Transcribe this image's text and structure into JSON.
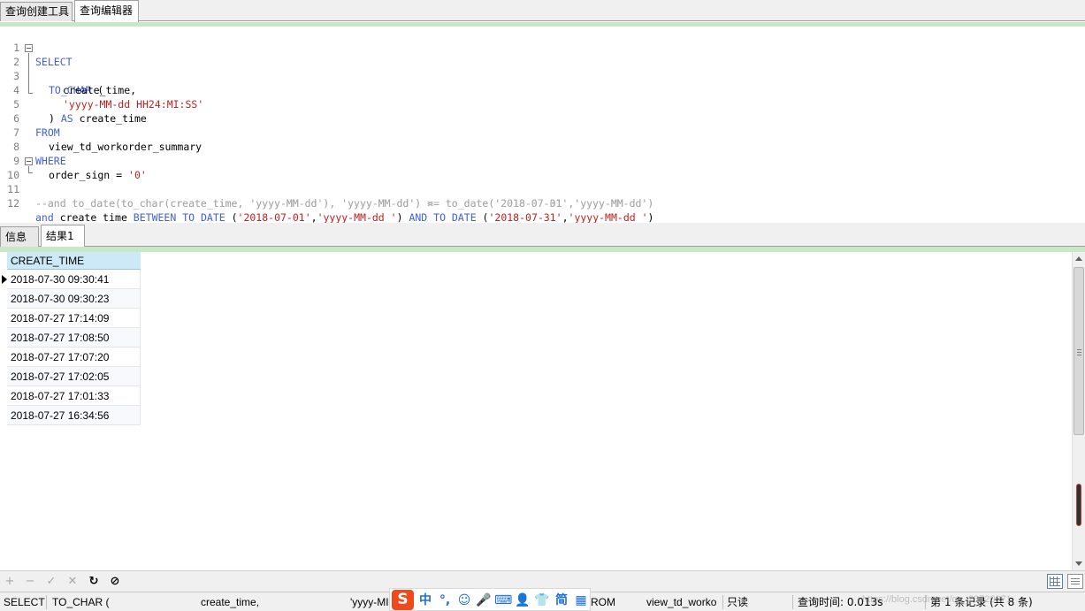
{
  "top_tabs": [
    {
      "label": "查询创建工具",
      "active": false
    },
    {
      "label": "查询编辑器",
      "active": true
    }
  ],
  "editor": {
    "line_numbers": [
      "1",
      "2",
      "3",
      "4",
      "5",
      "6",
      "7",
      "8",
      "9",
      "10",
      "11",
      "12"
    ],
    "lines": {
      "l1": {
        "kw": "SELECT"
      },
      "l2": {
        "kw": "TO_CHAR",
        "rest": " ("
      },
      "l3": {
        "text": "create_time,"
      },
      "l4": {
        "str": "'yyyy-MM-dd HH24:MI:SS'"
      },
      "l5": {
        "pre": ") ",
        "kw": "AS",
        "rest": " create_time"
      },
      "l6": {
        "kw": "FROM"
      },
      "l7": {
        "text": "view_td_workorder_summary"
      },
      "l8": {
        "kw": "WHERE"
      },
      "l9": {
        "pre": "order_sign = ",
        "str": "'0'"
      },
      "l10": {
        "comment": "--and to_date(to_char(create_time, 'yyyy-MM-dd'), 'yyyy-MM-dd') >= to_date('2018-07-01','yyyy-MM-dd')"
      },
      "l11": {
        "comment": "--and to_date(to_char(create_time, 'yyyy-MM-dd'), 'yyyy-MM-dd') <= to_date('2018-07-31','yyyy-MM-dd')"
      },
      "l12": {
        "kw1": "and",
        "t1": " create_time ",
        "kw2": "BETWEEN",
        "t2": " ",
        "kw3": "TO_DATE",
        "t3": " (",
        "s1": "'2018-07-01'",
        "t4": ",",
        "s2": "'yyyy-MM-dd '",
        "t5": ") ",
        "kw4": "AND",
        "t6": " ",
        "kw5": "TO_DATE",
        "t7": " (",
        "s3": "'2018-07-31'",
        "t8": ",",
        "s4": "'yyyy-MM-dd '",
        "t9": ")"
      }
    }
  },
  "bottom_tabs": [
    {
      "label": "信息",
      "active": false
    },
    {
      "label": "结果1",
      "active": true
    }
  ],
  "result": {
    "column": "CREATE_TIME",
    "rows": [
      "2018-07-30 09:30:41",
      "2018-07-30 09:30:23",
      "2018-07-27 17:14:09",
      "2018-07-27 17:08:50",
      "2018-07-27 17:07:20",
      "2018-07-27 17:02:05",
      "2018-07-27 17:01:33",
      "2018-07-27 16:34:56"
    ]
  },
  "toolbar": {
    "add": "+",
    "remove": "−",
    "apply": "✓",
    "discard": "✕",
    "refresh": "↻",
    "stop": "⊘"
  },
  "status": {
    "s1": "SELECT",
    "s2": "TO_CHAR (",
    "s3": "create_time,",
    "s4": "'yyyy-MI",
    "s5": "ROM",
    "s6": "view_td_worko",
    "s7": "只读",
    "s8": "查询时间: 0.013s",
    "s9": "第 1 条记录 (共 8 条)"
  },
  "ime": {
    "logo": "S",
    "lang": "中",
    "punct": "°,",
    "emoji": "☺",
    "voice": "🎤",
    "keyboard": "⌨",
    "user": "👤",
    "skin": "👕",
    "simplified": "简",
    "grid": "▦"
  },
  "watermark": "https://blog.csdn.net/qq_23720871"
}
